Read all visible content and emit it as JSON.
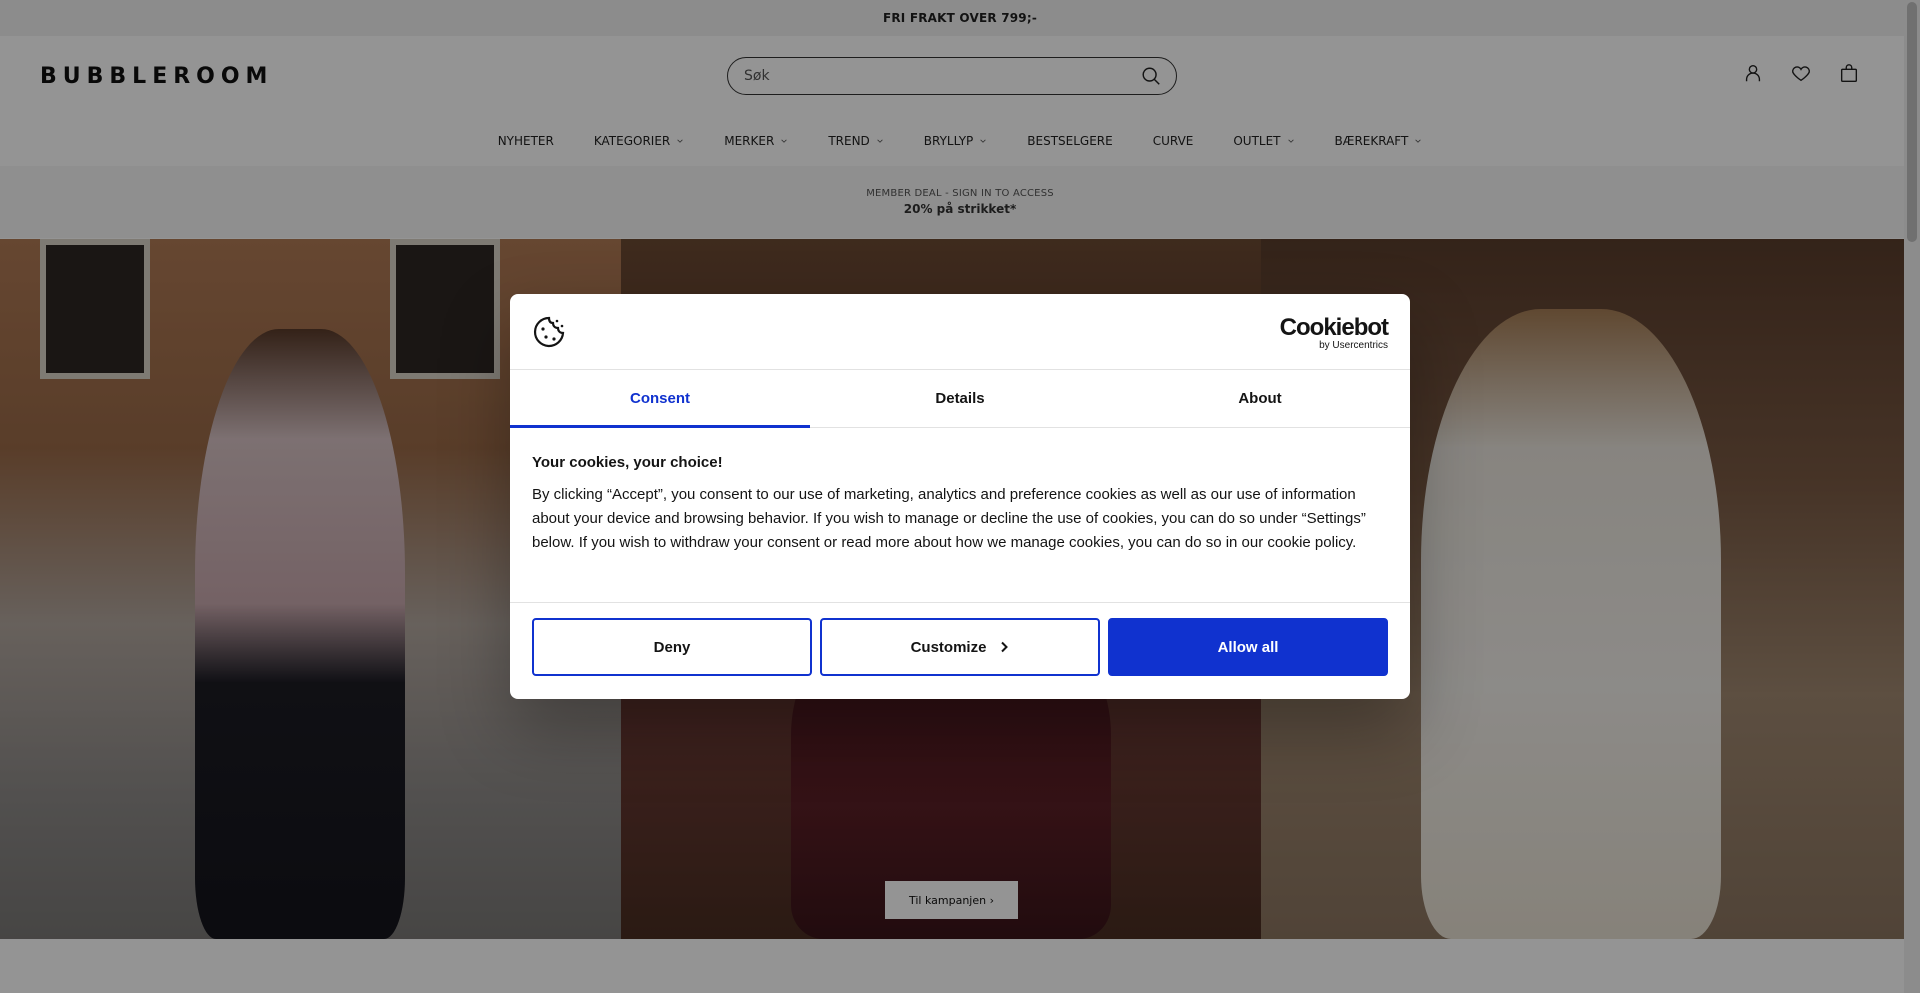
{
  "topbar": {
    "text": "FRI FRAKT OVER 799;-"
  },
  "header": {
    "logo": "BUBBLEROOM",
    "search_placeholder": "Søk"
  },
  "nav": {
    "items": [
      {
        "label": "NYHETER",
        "dropdown": false
      },
      {
        "label": "KATEGORIER",
        "dropdown": true
      },
      {
        "label": "MERKER",
        "dropdown": true
      },
      {
        "label": "TREND",
        "dropdown": true
      },
      {
        "label": "BRYLLYP",
        "dropdown": true
      },
      {
        "label": "BESTSELGERE",
        "dropdown": false
      },
      {
        "label": "CURVE",
        "dropdown": false
      },
      {
        "label": "OUTLET",
        "dropdown": true
      },
      {
        "label": "BÆREKRAFT",
        "dropdown": true
      }
    ]
  },
  "member_banner": {
    "line1": "MEMBER DEAL - SIGN IN TO ACCESS",
    "line2": "20% på strikket*"
  },
  "hero": {
    "cta_label": "Til kampanjen ›"
  },
  "cookie_dialog": {
    "brand_main": "Cookiebot",
    "brand_sub": "by Usercentrics",
    "tabs": [
      "Consent",
      "Details",
      "About"
    ],
    "active_tab": "Consent",
    "title": "Your cookies, your choice!",
    "body": "By clicking “Accept”, you consent to our use of marketing, analytics and preference cookies as well as our use of information about your device and browsing behavior. If you wish to manage or decline the use of cookies, you can do so under “Settings” below. If you wish to withdraw your consent or read more about how we manage cookies, you can do so in our cookie policy.",
    "buttons": {
      "deny": "Deny",
      "customize": "Customize",
      "allow_all": "Allow all"
    },
    "accent_color": "#1032cf"
  }
}
